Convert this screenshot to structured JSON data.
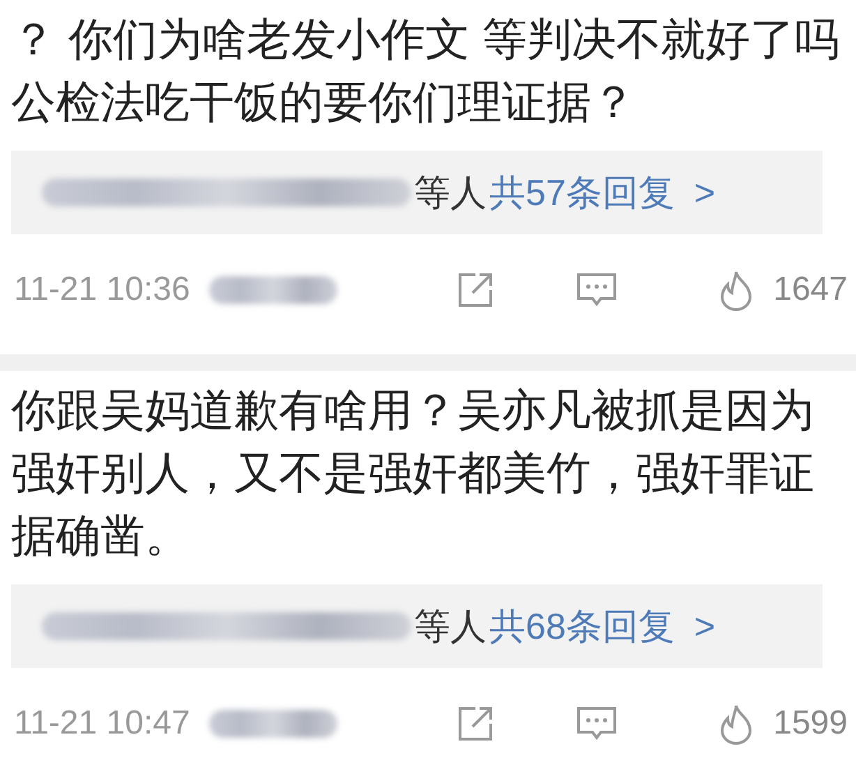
{
  "comments": [
    {
      "text": "？ 你们为啥老发小作文 等判决不就好了吗公检法吃干饭的要你们理证据？",
      "replies": {
        "suffix": "等人",
        "link": "共57条回复",
        "chevron": ">"
      },
      "time": "11-21 10:36",
      "likes": "1647"
    },
    {
      "text": "你跟吴妈道歉有啥用？吴亦凡被抓是因为强奸别人，又不是强奸都美竹，强奸罪证据确凿。",
      "replies": {
        "suffix": "等人",
        "link": "共68条回复",
        "chevron": ">"
      },
      "time": "11-21 10:47",
      "likes": "1599"
    }
  ]
}
